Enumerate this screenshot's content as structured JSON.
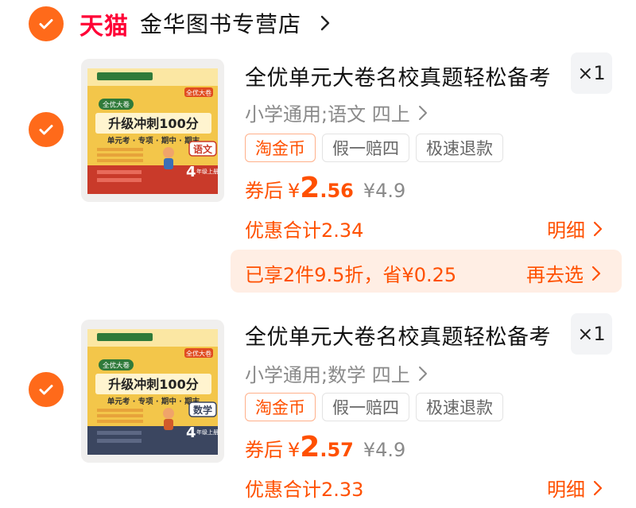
{
  "shop": {
    "brand": "天猫",
    "name": "金华图书专营店"
  },
  "items": [
    {
      "title": "全优单元大卷名校真题轻松备考",
      "quantity": "×1",
      "sku": "小学通用;语文 四上",
      "tags": [
        "淘金币",
        "假一赔四",
        "极速退款"
      ],
      "price_label": "券后",
      "currency": "¥",
      "price_int": "2",
      "price_dec": ".56",
      "original_price": "¥4.9",
      "discount_total": "优惠合计2.34",
      "detail_label": "明细",
      "cover": {
        "banner": "全优大卷",
        "corner": "全优大卷",
        "main": "升级冲刺100分",
        "sub": "单元考 · 专项 · 期中 · 期末",
        "subject": "语文",
        "grade": "4",
        "grade_note": "年级上册",
        "bottom_color": "#c93a2a"
      }
    },
    {
      "title": "全优单元大卷名校真题轻松备考",
      "quantity": "×1",
      "sku": "小学通用;数学 四上",
      "tags": [
        "淘金币",
        "假一赔四",
        "极速退款"
      ],
      "price_label": "券后",
      "currency": "¥",
      "price_int": "2",
      "price_dec": ".57",
      "original_price": "¥4.9",
      "discount_total": "优惠合计2.33",
      "detail_label": "明细",
      "cover": {
        "banner": "全优大卷",
        "corner": "全优大卷",
        "main": "升级冲刺100分",
        "sub": "单元考 · 专项 · 期中 · 期末",
        "subject": "数学",
        "grade": "4",
        "grade_note": "年级上册",
        "bottom_color": "#3b4660"
      }
    }
  ],
  "promo": {
    "text": "已享2件9.5折，省¥0.25",
    "link": "再去选"
  },
  "colors": {
    "accent": "#ff5000",
    "check": "#ff6a1a",
    "tmall": "#ff0036",
    "promo_bg": "#ffeee4"
  }
}
